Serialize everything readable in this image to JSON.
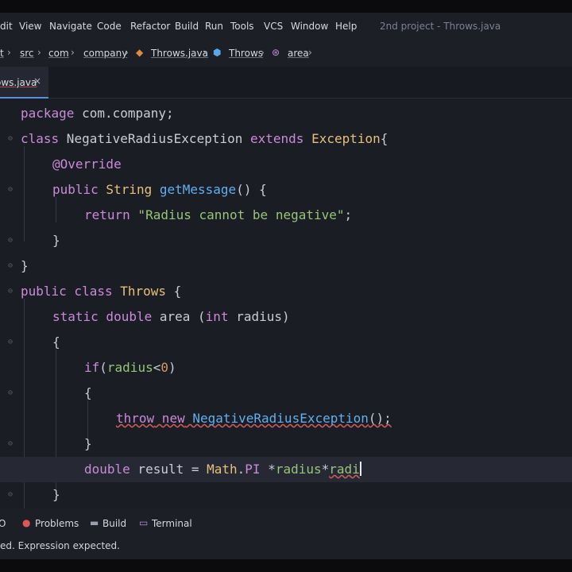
{
  "menu": {
    "items": [
      "dit",
      "View",
      "Navigate",
      "Code",
      "Refactor",
      "Build",
      "Run",
      "Tools",
      "VCS",
      "Window",
      "Help"
    ],
    "project_title": "2nd project - Throws.java"
  },
  "breadcrumb": {
    "items": [
      "t",
      "src",
      "com",
      "company",
      "Throws.java",
      "Throws",
      "area"
    ]
  },
  "tab": {
    "label": "ows.java",
    "close": "×"
  },
  "code": {
    "l1_kw": "package",
    "l1_rest": " com.company;",
    "l2_kw1": "class",
    "l2_name": " NegativeRadiusException ",
    "l2_kw2": "extends",
    "l2_sup": " Exception",
    "l2_brace": "{",
    "l3_ann": "@Override",
    "l4_kw": "public",
    "l4_type": " String ",
    "l4_fn": "getMessage",
    "l4_rest": "() {",
    "l5_kw": "return",
    "l5_str": " \"Radius cannot be negative\"",
    "l5_semi": ";",
    "l6": "}",
    "l7": "}",
    "l8_kw1": "public",
    "l8_kw2": " class",
    "l8_name": " Throws",
    "l8_rest": " {",
    "l9_kw1": "static",
    "l9_kw2": " double",
    "l9_fn": " area",
    "l9_p1": " (",
    "l9_kw3": "int",
    "l9_p2": " radius)",
    "l10": "{",
    "l11_kw": "if",
    "l11_p1": "(",
    "l11_id": "radius",
    "l11_op": "<",
    "l11_num": "0",
    "l11_p2": ")",
    "l12": "{",
    "l13_kw1": "throw",
    "l13_kw2": " new",
    "l13_cls": " NegativeRadiusException",
    "l13_rest": "();",
    "l14": "}",
    "l15_kw": "double",
    "l15_rest1": " result = ",
    "l15_cls": "Math",
    "l15_rest2": ".",
    "l15_pi": "PI",
    "l15_rest3": " *",
    "l15_id1": "radius",
    "l15_rest4": "*",
    "l15_id2": "radi",
    "l16": "}"
  },
  "toolwindows": {
    "todo": "O",
    "problems": "Problems",
    "build": "Build",
    "terminal": "Terminal"
  },
  "status": {
    "message": "ed. Expression expected."
  },
  "colors": {
    "keyword": "#c98bd8",
    "type": "#e5c07b",
    "string": "#98c379",
    "function": "#61afef",
    "identifier": "#e06c75",
    "number": "#d19a66",
    "error_icon": "#e05555"
  }
}
